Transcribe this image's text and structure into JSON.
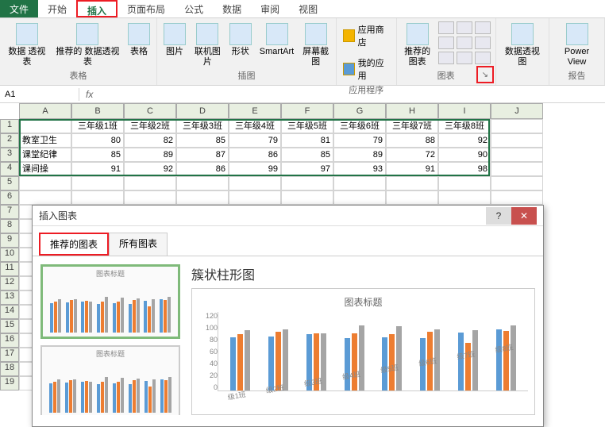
{
  "tabs": {
    "file": "文件",
    "home": "开始",
    "insert": "插入",
    "layout": "页面布局",
    "formula": "公式",
    "data": "数据",
    "review": "审阅",
    "view": "视图"
  },
  "ribbon": {
    "tables": {
      "pivot": "数据\n透视表",
      "recommend": "推荐的\n数据透视表",
      "table": "表格",
      "label": "表格"
    },
    "illus": {
      "pic": "图片",
      "online": "联机图片",
      "shapes": "形状",
      "smartart": "SmartArt",
      "screenshot": "屏幕截图",
      "label": "插图"
    },
    "apps": {
      "store": "应用商店",
      "myapps": "我的应用",
      "label": "应用程序"
    },
    "charts": {
      "recommend": "推荐的\n图表",
      "label": "图表"
    },
    "pivotchart": {
      "label": "数据透视图"
    },
    "report": {
      "power": "Power\nView",
      "label": "报告"
    }
  },
  "namebox": "A1",
  "columns": [
    "A",
    "B",
    "C",
    "D",
    "E",
    "F",
    "G",
    "H",
    "I",
    "J"
  ],
  "rows": [
    1,
    2,
    3,
    4,
    5,
    6,
    7,
    8,
    9,
    10,
    11,
    12,
    13,
    14,
    15,
    16,
    17,
    18,
    19
  ],
  "table": {
    "headers": [
      "三年级1班",
      "三年级2班",
      "三年级3班",
      "三年级4班",
      "三年级5班",
      "三年级6班",
      "三年级7班",
      "三年级8班"
    ],
    "rowLabels": [
      "教室卫生",
      "课堂纪律",
      "课间操"
    ],
    "data": [
      [
        80,
        82,
        85,
        79,
        81,
        79,
        88,
        92
      ],
      [
        85,
        89,
        87,
        86,
        85,
        89,
        72,
        90
      ],
      [
        91,
        92,
        86,
        99,
        97,
        93,
        91,
        98
      ]
    ]
  },
  "dialog": {
    "title": "插入图表",
    "tab1": "推荐的图表",
    "tab2": "所有图表",
    "thumbTitle": "图表标题",
    "chartType": "簇状柱形图",
    "previewTitle": "图表标题",
    "yticks": [
      "120",
      "100",
      "80",
      "60",
      "40",
      "20",
      "0"
    ],
    "xcats": [
      "级1班",
      "级2班",
      "级3班",
      "级4班",
      "级5班",
      "级6班",
      "级7班",
      "级8班"
    ]
  },
  "chart_data": {
    "type": "bar",
    "title": "图表标题",
    "categories": [
      "三年级1班",
      "三年级2班",
      "三年级3班",
      "三年级4班",
      "三年级5班",
      "三年级6班",
      "三年级7班",
      "三年级8班"
    ],
    "series": [
      {
        "name": "教室卫生",
        "values": [
          80,
          82,
          85,
          79,
          81,
          79,
          88,
          92
        ]
      },
      {
        "name": "课堂纪律",
        "values": [
          85,
          89,
          87,
          86,
          85,
          89,
          72,
          90
        ]
      },
      {
        "name": "课间操",
        "values": [
          91,
          92,
          86,
          99,
          97,
          93,
          91,
          98
        ]
      }
    ],
    "ylim": [
      0,
      120
    ],
    "ylabel": "",
    "xlabel": ""
  }
}
